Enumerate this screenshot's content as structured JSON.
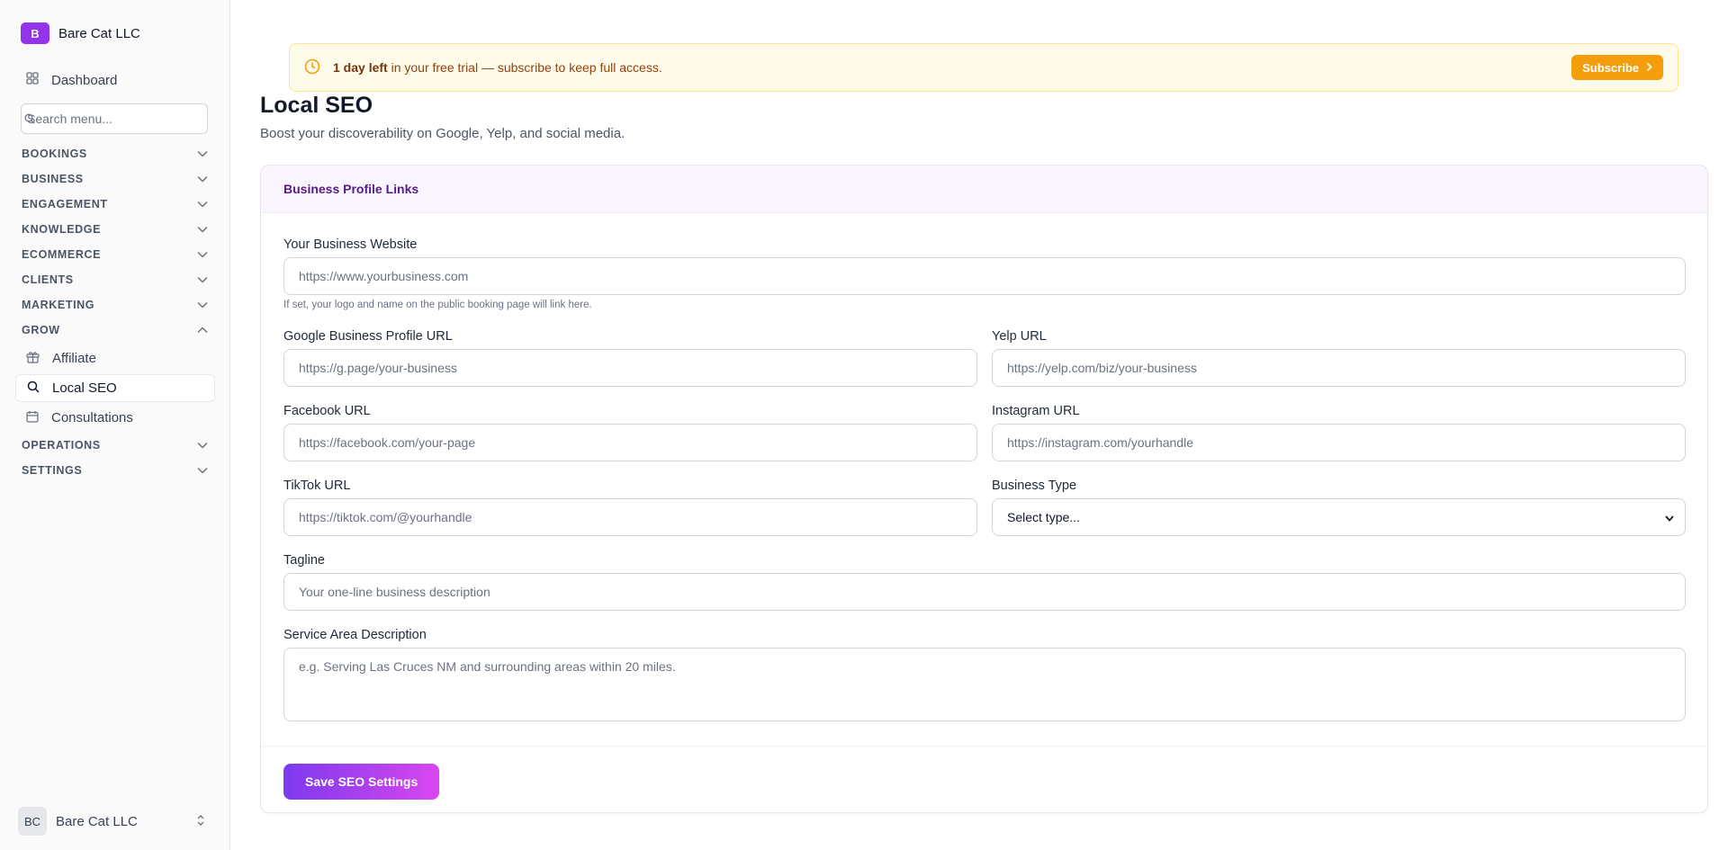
{
  "sidebar": {
    "brand_initial": "B",
    "brand_name": "Bare Cat LLC",
    "dashboard_label": "Dashboard",
    "search_placeholder": "Search menu...",
    "sections": [
      {
        "label": "BOOKINGS",
        "expanded": false
      },
      {
        "label": "BUSINESS",
        "expanded": false
      },
      {
        "label": "ENGAGEMENT",
        "expanded": false
      },
      {
        "label": "KNOWLEDGE",
        "expanded": false
      },
      {
        "label": "ECOMMERCE",
        "expanded": false
      },
      {
        "label": "CLIENTS",
        "expanded": false
      },
      {
        "label": "MARKETING",
        "expanded": false
      },
      {
        "label": "GROW",
        "expanded": true
      },
      {
        "label": "OPERATIONS",
        "expanded": false
      },
      {
        "label": "SETTINGS",
        "expanded": false
      }
    ],
    "grow_items": [
      {
        "label": "Affiliate",
        "icon": "gift-icon",
        "active": false
      },
      {
        "label": "Local SEO",
        "icon": "search-icon",
        "active": true
      },
      {
        "label": "Consultations",
        "icon": "calendar-icon",
        "active": false
      }
    ],
    "user": {
      "initials": "BC",
      "name": "Bare Cat LLC"
    }
  },
  "banner": {
    "bold": "1 day left",
    "text": " in your free trial — subscribe to keep full access.",
    "button": "Subscribe"
  },
  "page": {
    "title": "Local SEO",
    "subtitle": "Boost your discoverability on Google, Yelp, and social media."
  },
  "card": {
    "title": "Business Profile Links",
    "website_label": "Your Business Website",
    "website_placeholder": "https://www.yourbusiness.com",
    "website_help": "If set, your logo and name on the public booking page will link here.",
    "google_label": "Google Business Profile URL",
    "google_placeholder": "https://g.page/your-business",
    "yelp_label": "Yelp URL",
    "yelp_placeholder": "https://yelp.com/biz/your-business",
    "facebook_label": "Facebook URL",
    "facebook_placeholder": "https://facebook.com/your-page",
    "instagram_label": "Instagram URL",
    "instagram_placeholder": "https://instagram.com/yourhandle",
    "tiktok_label": "TikTok URL",
    "tiktok_placeholder": "https://tiktok.com/@yourhandle",
    "type_label": "Business Type",
    "type_value": "Select type...",
    "tagline_label": "Tagline",
    "tagline_placeholder": "Your one-line business description",
    "service_label": "Service Area Description",
    "service_placeholder": "e.g. Serving Las Cruces NM and surrounding areas within 20 miles.",
    "save_button": "Save SEO Settings"
  },
  "colors": {
    "brand": "#9333ea",
    "banner_bg": "#fffbeb",
    "subscribe": "#f59e0b",
    "card_header_bg": "#faf5ff",
    "save_gradient_start": "#7c3aed",
    "save_gradient_end": "#d946ef"
  }
}
